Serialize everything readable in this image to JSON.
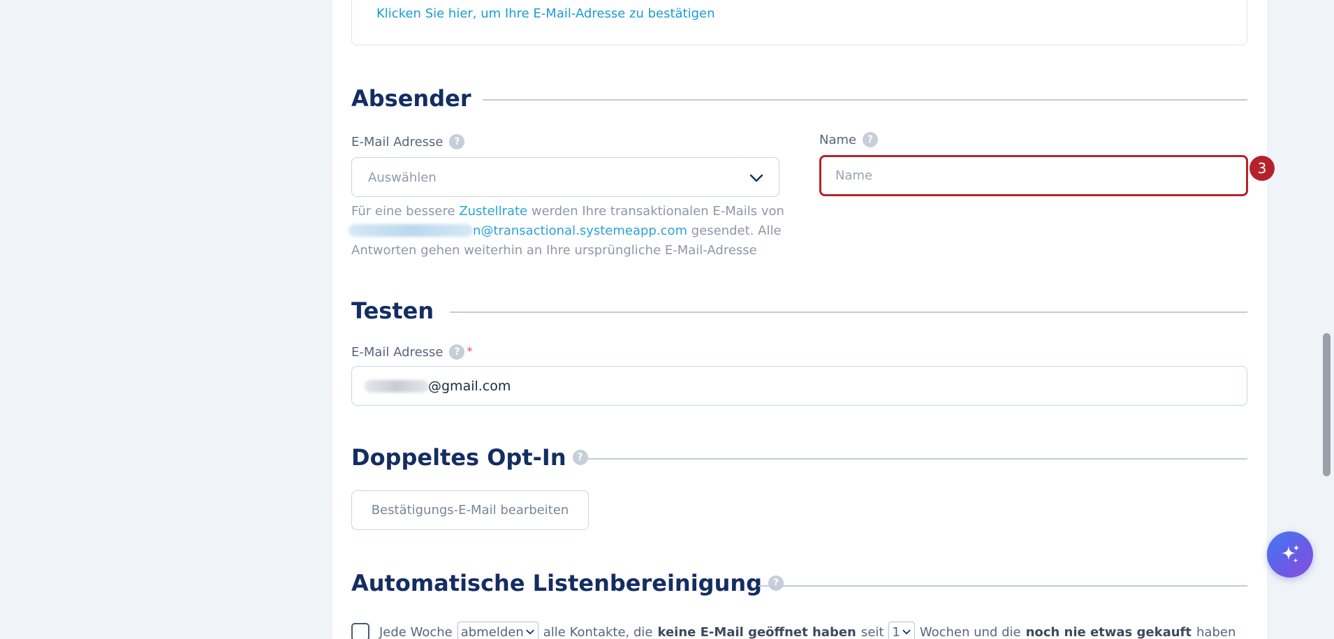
{
  "confirm_link": "Klicken Sie hier, um Ihre E-Mail-Adresse zu bestätigen",
  "sender": {
    "title": "Absender",
    "email_label": "E-Mail Adresse",
    "email_placeholder": "Auswählen",
    "hint_prefix": "Für eine bessere ",
    "hint_link": "Zustellrate",
    "hint_middle": " werden Ihre transaktionalen E-Mails von ",
    "hint_domain": "n@transactional.systemeapp.com",
    "hint_suffix": " gesendet. Alle Antworten gehen weiterhin an Ihre ursprüngliche E-Mail-Adresse",
    "name_label": "Name",
    "name_placeholder": "Name",
    "step_number": "3"
  },
  "test": {
    "title": "Testen",
    "email_label": "E-Mail Adresse",
    "required_mark": "*",
    "email_value": "@gmail.com"
  },
  "double_optin": {
    "title": "Doppeltes Opt-In",
    "button_label": "Bestätigungs-E-Mail bearbeiten"
  },
  "list_cleaning": {
    "title": "Automatische Listenbereinigung",
    "text_1": "Jede Woche",
    "action_value": "abmelden",
    "text_2": "alle Kontakte, die",
    "bold_1": "keine E-Mail geöffnet haben",
    "text_3": "seit",
    "weeks_value": "1",
    "text_4": "Wochen und die",
    "bold_2": "noch nie etwas gekauft",
    "text_5": "haben"
  },
  "help_glyph": "?",
  "colors": {
    "accent_link": "#1a9bd7",
    "heading": "#142d63",
    "error_highlight": "#b4232c"
  },
  "icons": {
    "dropdown": "chevron-down-icon",
    "help": "question-circle-icon",
    "ai": "sparkle-icon"
  }
}
